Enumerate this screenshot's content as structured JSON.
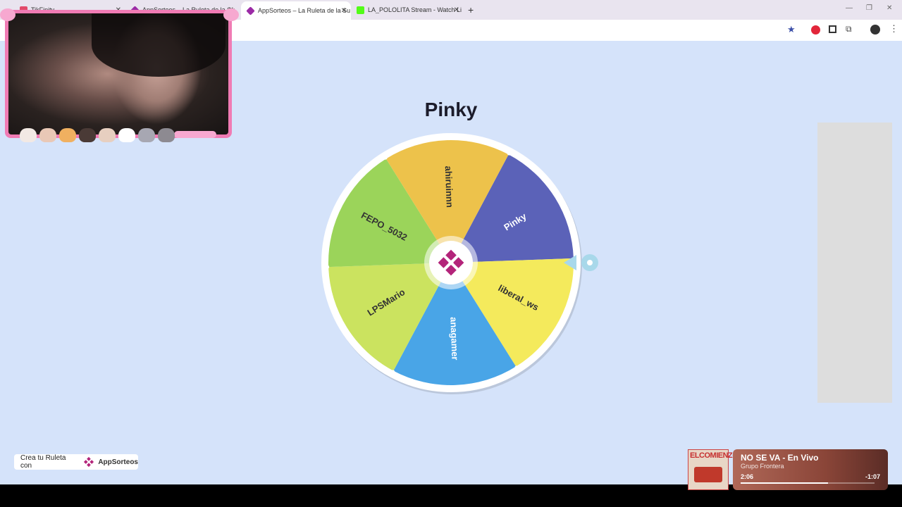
{
  "browser": {
    "tabs": [
      {
        "title": "TikFinity",
        "fav_color": "#e24a6a"
      },
      {
        "title": "AppSorteos – La Ruleta de la Su",
        "fav_color": "#9b2aa6"
      },
      {
        "title": "AppSorteos – La Ruleta de la Su",
        "fav_color": "#9b2aa6",
        "active": true
      },
      {
        "title": "LA_POLOLITA Stream - Watch Li",
        "fav_color": "#53fc18"
      }
    ],
    "new_tab_label": "+",
    "close_glyph": "✕"
  },
  "wheel": {
    "winner": "Pinky",
    "segments": [
      {
        "label": "Pinky",
        "color": "#5b62b8",
        "text_color": "#ffffff"
      },
      {
        "label": "liberal_ws",
        "color": "#f4ea5c",
        "text_color": "#333333"
      },
      {
        "label": "anagamer",
        "color": "#49a5e7",
        "text_color": "#ffffff"
      },
      {
        "label": "LPSMario",
        "color": "#cbe35f",
        "text_color": "#333333"
      },
      {
        "label": "FEPO_5032",
        "color": "#9bd45a",
        "text_color": "#333333"
      },
      {
        "label": "ahiruinnn",
        "color": "#edc24b",
        "text_color": "#333333"
      }
    ],
    "center_color": "#b3247a",
    "pointer_color": "#a8d8ea"
  },
  "credit": {
    "prefix": "Crea tu Ruleta con",
    "brand": "AppSorteos"
  },
  "music": {
    "album_text": "ELCOMIENZO",
    "title": "NO SE VA - En Vivo",
    "artist": "Grupo Frontera",
    "current": "2:06",
    "remaining": "-1:07",
    "progress": 0.65
  }
}
